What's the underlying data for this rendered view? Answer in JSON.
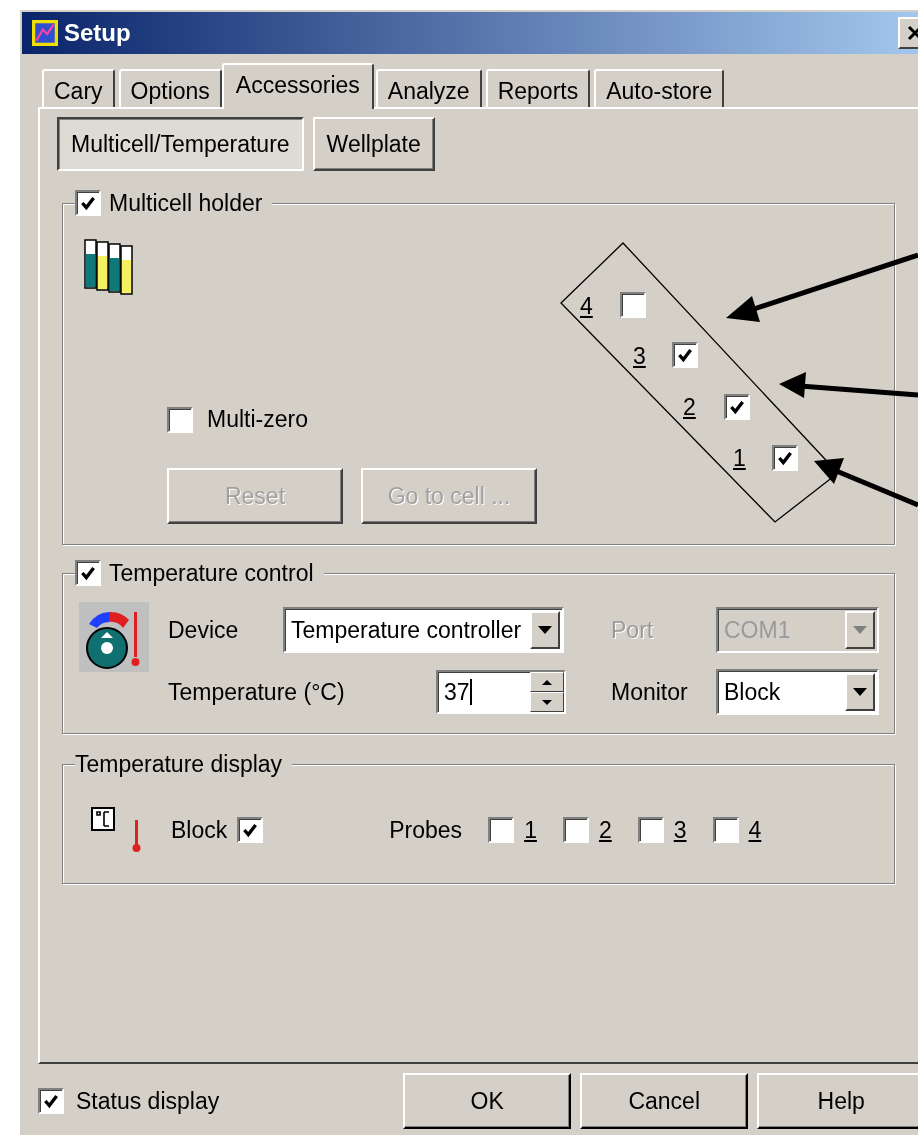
{
  "window": {
    "title": "Setup"
  },
  "tabs": [
    {
      "label": "Cary",
      "selected": false
    },
    {
      "label": "Options",
      "selected": false
    },
    {
      "label": "Accessories",
      "selected": true
    },
    {
      "label": "Analyze",
      "selected": false
    },
    {
      "label": "Reports",
      "selected": false
    },
    {
      "label": "Auto-store",
      "selected": false
    }
  ],
  "subtabs": [
    {
      "label": "Multicell/Temperature",
      "selected": true
    },
    {
      "label": "Wellplate",
      "selected": false
    }
  ],
  "multicell_holder": {
    "label": "Multicell holder",
    "checked": true,
    "multi_zero": {
      "label": "Multi-zero",
      "checked": false
    },
    "buttons": [
      {
        "label": "Reset",
        "disabled": true
      },
      {
        "label": "Go to cell ...",
        "disabled": true
      }
    ],
    "cells": [
      {
        "label": "4",
        "checked": false
      },
      {
        "label": "3",
        "checked": true
      },
      {
        "label": "2",
        "checked": true
      },
      {
        "label": "1",
        "checked": true
      }
    ]
  },
  "temperature_control": {
    "label": "Temperature control",
    "checked": true,
    "device": {
      "label": "Device",
      "value": "Temperature controller",
      "disabled": false
    },
    "port": {
      "label": "Port",
      "value": "COM1",
      "disabled": true
    },
    "temperature": {
      "label": "Temperature (°C)",
      "value": "37"
    },
    "monitor": {
      "label": "Monitor",
      "value": "Block",
      "disabled": false
    }
  },
  "temperature_display": {
    "label": "Temperature display",
    "block": {
      "label": "Block",
      "checked": true
    },
    "probes_label": "Probes",
    "probes": [
      {
        "label": "1",
        "checked": false
      },
      {
        "label": "2",
        "checked": false
      },
      {
        "label": "3",
        "checked": false
      },
      {
        "label": "4",
        "checked": false
      }
    ]
  },
  "status_display": {
    "label": "Status display",
    "checked": true
  },
  "buttons": [
    {
      "label": "OK"
    },
    {
      "label": "Cancel"
    },
    {
      "label": "Help"
    }
  ]
}
